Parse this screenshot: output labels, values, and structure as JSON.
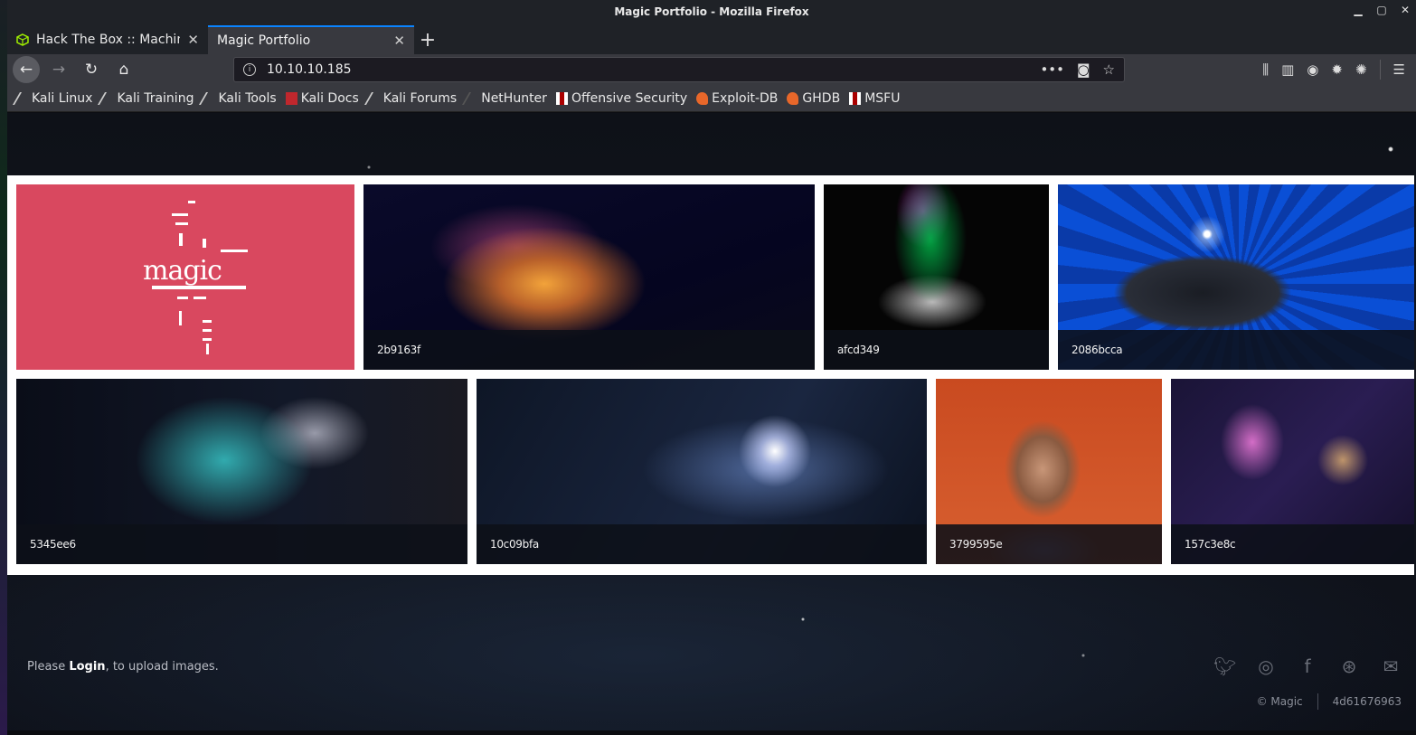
{
  "window": {
    "title": "Magic Portfolio - Mozilla Firefox",
    "controls": [
      "minimize",
      "maximize",
      "close"
    ]
  },
  "tabs": [
    {
      "label": "Hack The Box :: Machines",
      "icon": "hackthebox-cube-icon",
      "active": false
    },
    {
      "label": "Magic Portfolio",
      "icon": "",
      "active": true
    }
  ],
  "navigation": {
    "url": "10.10.10.185"
  },
  "bookmarks": [
    {
      "label": "Kali Linux",
      "icon": "kali-dragon-icon"
    },
    {
      "label": "Kali Training",
      "icon": "kali-dragon-icon"
    },
    {
      "label": "Kali Tools",
      "icon": "kali-dragon-icon"
    },
    {
      "label": "Kali Docs",
      "icon": "kali-docs-icon"
    },
    {
      "label": "Kali Forums",
      "icon": "kali-dragon-icon"
    },
    {
      "label": "NetHunter",
      "icon": "nethunter-icon"
    },
    {
      "label": "Offensive Security",
      "icon": "offsec-icon"
    },
    {
      "label": "Exploit-DB",
      "icon": "exploitdb-icon"
    },
    {
      "label": "GHDB",
      "icon": "ghdb-icon"
    },
    {
      "label": "MSFU",
      "icon": "offsec-icon"
    }
  ],
  "gallery": {
    "logo_text": "magic",
    "captions": [
      "2b9163f",
      "afcd349",
      "2086bcca",
      "5345ee6",
      "10c09bfa",
      "3799595e",
      "157c3e8c"
    ]
  },
  "footer": {
    "prefix": "Please ",
    "login_label": "Login",
    "suffix": ", to upload images.",
    "social": [
      "twitter-icon",
      "instagram-icon",
      "facebook-icon",
      "dribbble-icon",
      "email-icon"
    ],
    "copyright": "© Magic",
    "hash": "4d61676963"
  },
  "colors": {
    "logo_tile": "#d9485f",
    "active_tab_accent": "#0a84ff",
    "chrome": "#38393f"
  }
}
